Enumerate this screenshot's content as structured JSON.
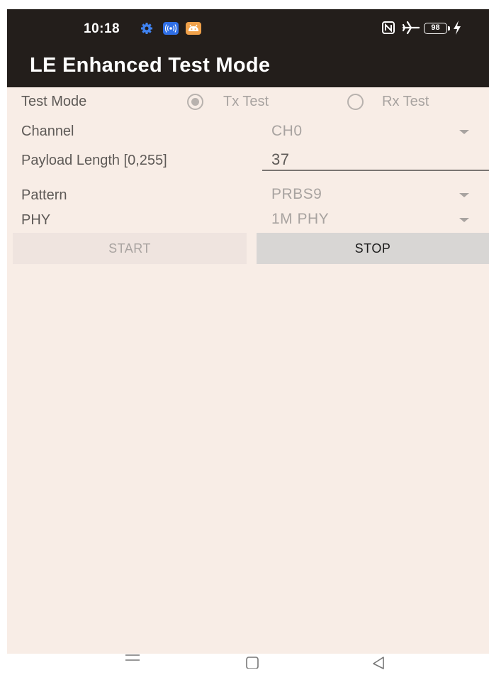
{
  "status_bar": {
    "time": "10:18",
    "battery": "98",
    "icons": [
      "gear-icon",
      "radio-wave-icon",
      "android-icon",
      "nfc-icon",
      "airplane-icon",
      "battery-icon",
      "charging-icon"
    ]
  },
  "app_bar": {
    "title": "LE Enhanced Test Mode"
  },
  "form": {
    "test_mode": {
      "label": "Test Mode",
      "options": [
        "Tx Test",
        "Rx Test"
      ],
      "selected": "Tx Test"
    },
    "channel": {
      "label": "Channel",
      "value": "CH0"
    },
    "payload_length": {
      "label": "Payload Length [0,255]",
      "value": "37"
    },
    "pattern": {
      "label": "Pattern",
      "value": "PRBS9"
    },
    "phy": {
      "label": "PHY",
      "value": "1M PHY"
    }
  },
  "buttons": {
    "start": "START",
    "stop": "STOP"
  },
  "colors": {
    "app_bar": "#231e1b",
    "background": "#f8ede6",
    "stop_button": "#d8d6d4",
    "start_button": "#efe4df"
  },
  "nav_bar": {
    "icons": [
      "menu-icon",
      "home-icon",
      "back-icon"
    ]
  }
}
